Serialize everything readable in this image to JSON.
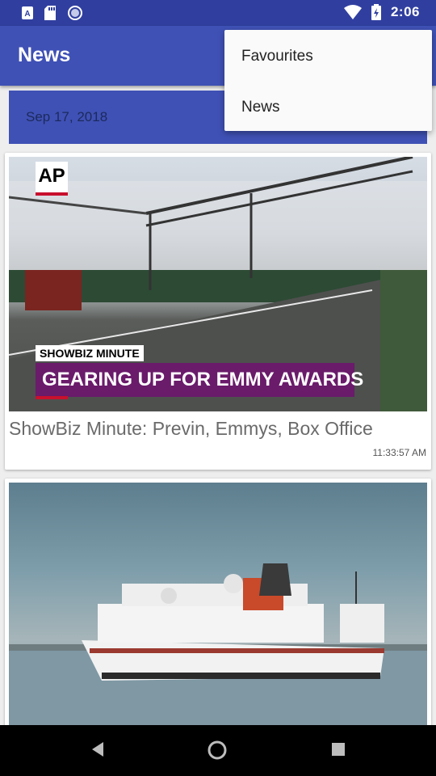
{
  "status_bar": {
    "time": "2:06",
    "icons": [
      "a-notification-icon",
      "sd-card-icon",
      "sync-circle-icon",
      "wifi-icon",
      "battery-icon"
    ]
  },
  "app_bar": {
    "title": "News"
  },
  "overflow_menu": {
    "items": [
      {
        "label": "Favourites"
      },
      {
        "label": "News"
      }
    ]
  },
  "date_header": {
    "date": "Sep 17, 2018"
  },
  "articles": [
    {
      "title": "ShowBiz Minute: Previn, Emmys, Box Office",
      "time": "11:33:57 AM",
      "image": {
        "logo_text": "AP",
        "banner_label": "SHOWBIZ MINUTE",
        "banner_headline": "GEARING UP FOR EMMY AWARDS"
      }
    },
    {
      "title": "",
      "time": "",
      "image": {}
    }
  ],
  "nav_bar": {
    "buttons": [
      "back-icon",
      "home-icon",
      "recents-icon"
    ]
  },
  "colors": {
    "primary": "#3f51b5",
    "primary_dark": "#303f9f",
    "accent_purple": "#6a1b6a",
    "ap_red": "#c8102e"
  }
}
